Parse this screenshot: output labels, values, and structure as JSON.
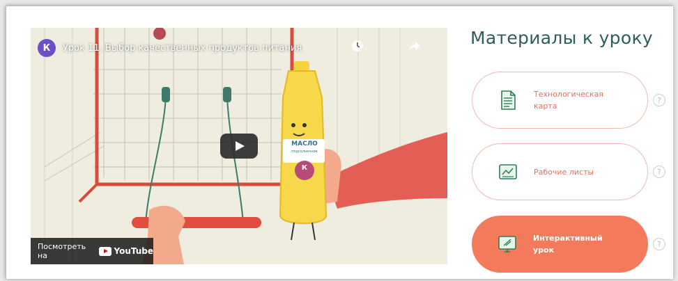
{
  "video": {
    "channel_avatar_letter": "К",
    "title": "Урок 11. Выбор качественных продуктов питания",
    "watch_later_icon": "clock-icon",
    "share_icon": "share-icon",
    "play_icon": "play-icon",
    "watch_on_label": "Посмотреть на",
    "youtube_label": "YouTube",
    "bottle_label": "МАСЛО",
    "bottle_sublabel": "подсолнечное",
    "bottle_badge": "К"
  },
  "materials": {
    "title": "Материалы к уроку",
    "items": [
      {
        "line1": "Технологическая",
        "line2": "карта",
        "icon": "document-icon",
        "style": "outline"
      },
      {
        "line1": "Рабочие листы",
        "line2": "",
        "icon": "worksheet-icon",
        "style": "outline"
      },
      {
        "line1": "Интерактивный",
        "line2": "урок",
        "icon": "interactive-screen-icon",
        "style": "filled"
      }
    ],
    "help_symbol": "?"
  },
  "colors": {
    "accent": "#f47a5c",
    "title": "#2e5d5c",
    "outline": "#f3b9ac"
  }
}
